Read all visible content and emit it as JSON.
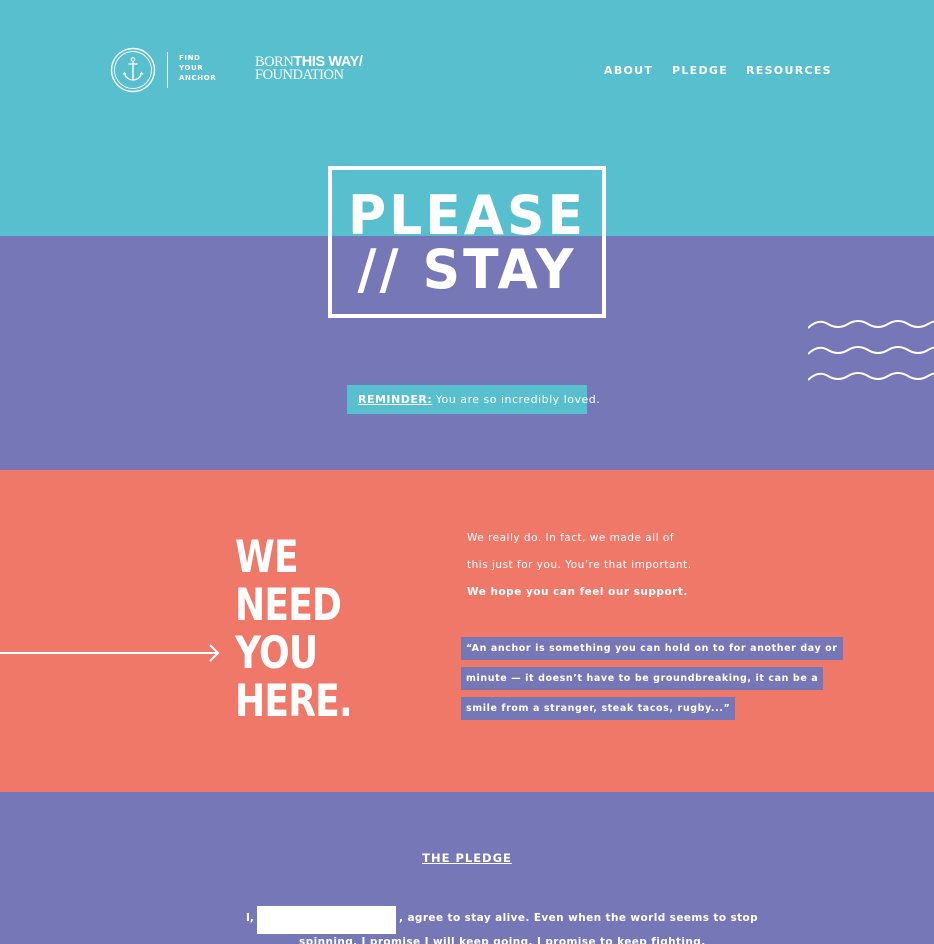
{
  "header": {
    "find_anchor_lines": [
      "FIND",
      "YOUR",
      "ANCHOR"
    ],
    "btw_logo": {
      "born": "BORN",
      "this_way": "THIS WAY/",
      "foundation": "FOUNDATION"
    },
    "nav": [
      "ABOUT",
      "PLEDGE",
      "RESOURCES"
    ]
  },
  "hero": {
    "line1": "PLEASE",
    "line2": "// STAY"
  },
  "reminder": {
    "label": "REMINDER:",
    "text": "You are so incredibly loved."
  },
  "need_section": {
    "headline_lines": [
      "WE",
      "NEED",
      "YOU",
      "HERE."
    ],
    "intro_lines": [
      "We really do. In fact, we made all of",
      "this just for you. You’re that important.",
      "We hope you can feel our support."
    ],
    "quote_lines": [
      "“An anchor is something you can hold on to for another day or",
      "minute — it doesn’t have to be groundbreaking, it can be a",
      "smile from a stranger, steak tacos, rugby...”"
    ]
  },
  "pledge": {
    "title": "THE PLEDGE",
    "prefix": "I,",
    "name_value": "",
    "line1_rest": ", agree to stay alive. Even when the world seems to stop",
    "line2": "spinning, I promise I will keep going. I promise to keep fighting."
  },
  "colors": {
    "teal": "#57bfcd",
    "purple": "#7577b7",
    "coral": "#f07868",
    "white": "#ffffff"
  }
}
